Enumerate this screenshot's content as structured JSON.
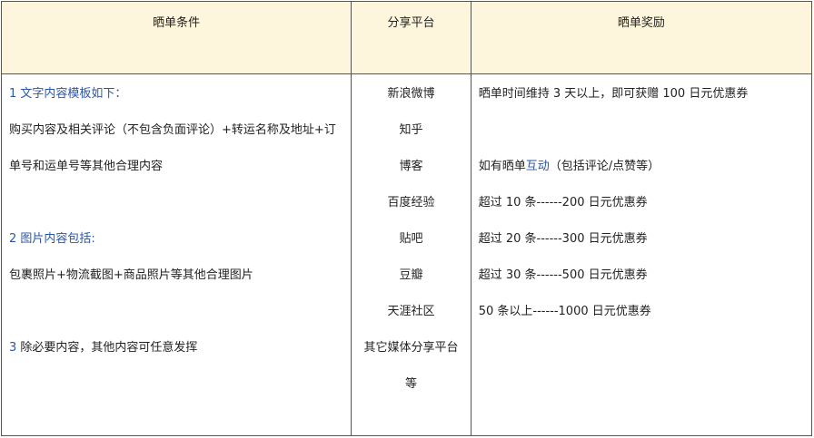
{
  "headers": {
    "conditions": "晒单条件",
    "platforms": "分享平台",
    "rewards": "晒单奖励"
  },
  "conditions": {
    "item1_title": "1 文字内容模板如下：",
    "item1_line1": "购买内容及相关评论（不包含负面评论）+转运名称及地址+订",
    "item1_line2": "单号和运单号等其他合理内容",
    "item2_title": "2 图片内容包括:",
    "item2_line1": "包裹照片+物流截图+商品照片等其他合理图片",
    "item3_number": "3",
    "item3_text": " 除必要内容，其他内容可任意发挥"
  },
  "platforms": [
    "新浪微博",
    "知乎",
    "博客",
    "百度经验",
    "贴吧",
    "豆瓣",
    "天涯社区",
    "其它媒体分享平台",
    "等"
  ],
  "rewards": {
    "line1": "晒单时间维持 3 天以上，即可获赠 100 日元优惠券",
    "line2_prefix": "如有晒单",
    "line2_link": "互动",
    "line2_suffix": "（包括评论/点赞等）",
    "tiers": [
      "超过 10 条------200 日元优惠券",
      "超过 20 条------300 日元优惠券",
      "超过 30 条------500 日元优惠券",
      "50 条以上------1000 日元优惠券"
    ]
  }
}
